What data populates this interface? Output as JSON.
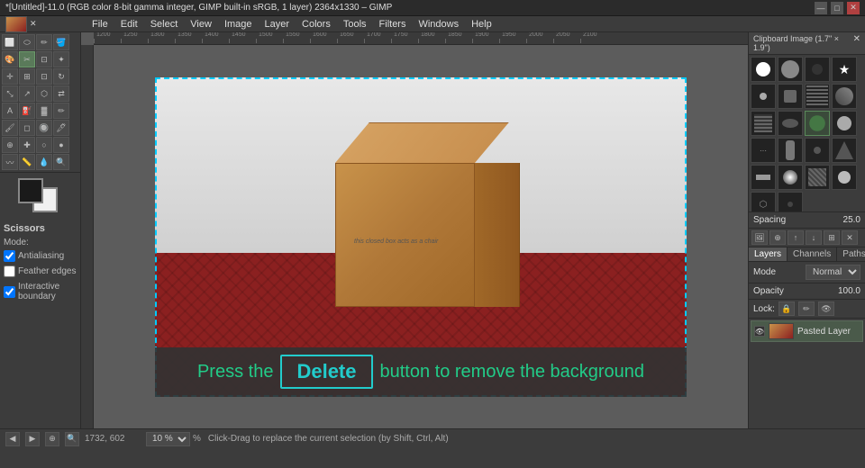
{
  "titlebar": {
    "title": "*[Untitled]-11.0 (RGB color 8-bit gamma integer, GIMP built-in sRGB, 1 layer) 2364x1330 – GIMP",
    "controls": [
      "—",
      "□",
      "✕"
    ]
  },
  "menubar": {
    "items": [
      "File",
      "Edit",
      "Select",
      "View",
      "Image",
      "Layer",
      "Colors",
      "Tools",
      "Filters",
      "Windows",
      "Help"
    ]
  },
  "toolbox": {
    "options_label": "Scissors",
    "mode_label": "Mode:",
    "antialiasing_label": "Antialiasing",
    "feather_label": "Feather edges",
    "interactive_label": "Interactive boundary"
  },
  "brushes": {
    "title": "Clipboard Image (1.7\" × 1.9\")"
  },
  "layers": {
    "spacing_label": "Spacing",
    "spacing_value": "25.0",
    "tabs": [
      "Layers",
      "Channels",
      "Paths"
    ],
    "mode_label": "Mode",
    "mode_value": "Normal",
    "opacity_label": "Opacity",
    "opacity_value": "100.0",
    "lock_label": "Lock:",
    "layer_name": "Pasted Layer"
  },
  "canvas": {
    "box_text": "this closed box acts as a chair",
    "selection_active": true
  },
  "instruction": {
    "press_text": "Press the",
    "key_label": "Delete",
    "rest_text": "button to remove the background"
  },
  "statusbar": {
    "coords": "1732, 602",
    "zoom_value": "10 %",
    "message": "Click-Drag to replace the current selection (by Shift, Ctrl, Alt)"
  }
}
